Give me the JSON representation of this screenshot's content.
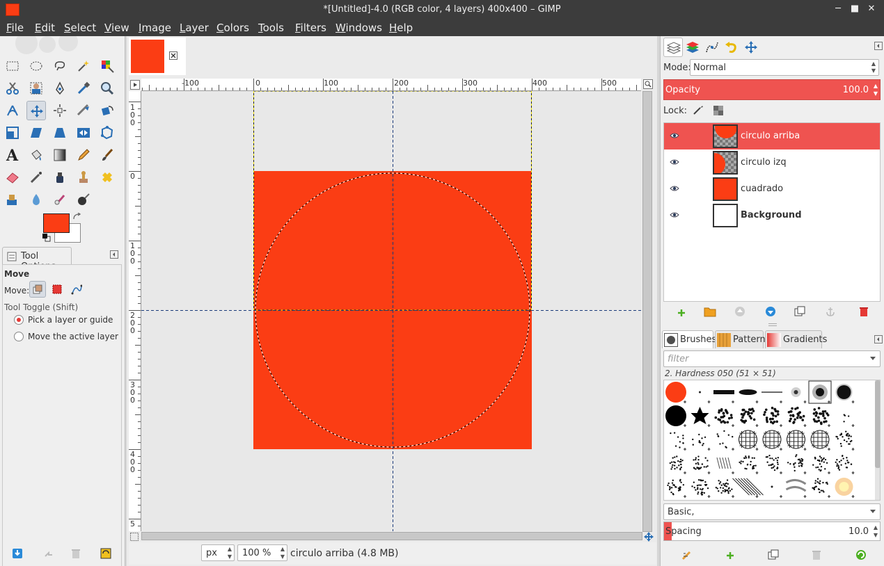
{
  "window": {
    "title": "*[Untitled]-4.0 (RGB color, 4 layers) 400x400 – GIMP",
    "minimize_icon": "minimize-icon",
    "maximize_icon": "maximize-icon",
    "close_icon": "close-icon"
  },
  "menu": [
    "File",
    "Edit",
    "Select",
    "View",
    "Image",
    "Layer",
    "Colors",
    "Tools",
    "Filters",
    "Windows",
    "Help"
  ],
  "colors": {
    "foreground": "#fb3d14",
    "background": "#ffffff",
    "selection": "#ef5350"
  },
  "tool_options": {
    "tab_label": "Tool Options",
    "tool_name": "Move",
    "move_label": "Move:",
    "toggle_label": "Tool Toggle  (Shift)",
    "options": [
      {
        "label": "Pick a layer or guide",
        "checked": true
      },
      {
        "label": "Move the active layer",
        "checked": false
      }
    ]
  },
  "ruler": {
    "h_labels": [
      "-100",
      "0",
      "100",
      "200",
      "300",
      "400",
      "500"
    ],
    "v_labels": [
      "1\n0\n0",
      "0",
      "1\n0\n0",
      "2\n0\n0",
      "3\n0\n0",
      "4\n0\n0",
      "5"
    ]
  },
  "status": {
    "unit": "px",
    "zoom": "100 %",
    "message": "circulo arriba (4.8 MB)"
  },
  "layers_panel": {
    "mode_label": "Mode:",
    "mode_value": "Normal",
    "opacity_label": "Opacity",
    "opacity_value": "100.0",
    "lock_label": "Lock:",
    "layers": [
      {
        "name": "circulo arriba",
        "selected": true,
        "bold": false
      },
      {
        "name": "circulo izq",
        "selected": false,
        "bold": false
      },
      {
        "name": "cuadrado",
        "selected": false,
        "bold": false
      },
      {
        "name": "Background",
        "selected": false,
        "bold": true
      }
    ]
  },
  "brushes_panel": {
    "tabs": [
      "Brushes",
      "Patterns",
      "Gradients"
    ],
    "filter_placeholder": "filter",
    "brush_name": "2. Hardness 050 (51 × 51)",
    "tag": "Basic,",
    "spacing_label": "Spacing",
    "spacing_value": "10.0"
  }
}
